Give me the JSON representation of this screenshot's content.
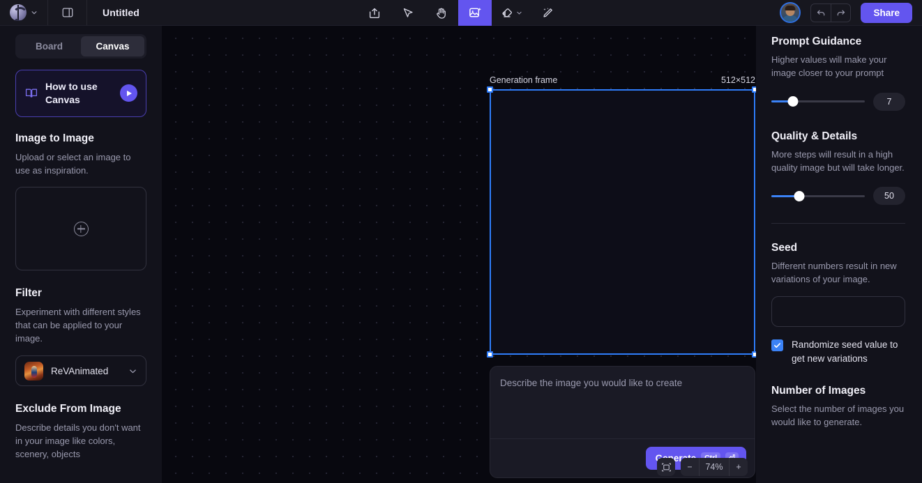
{
  "topbar": {
    "logo_icon": "app-logo",
    "workspace_chevron_icon": "chevron-down-icon",
    "panel_toggle_icon": "sidebar-panel-icon",
    "document_title": "Untitled",
    "tools": [
      {
        "name": "import-image-tool",
        "icon": "upload-frame-icon",
        "active": false
      },
      {
        "name": "select-tool",
        "icon": "cursor-arrow-icon",
        "active": false
      },
      {
        "name": "pan-tool",
        "icon": "hand-icon",
        "active": false
      },
      {
        "name": "generate-image-tool",
        "icon": "image-sparkle-icon",
        "active": true
      },
      {
        "name": "eraser-tool",
        "icon": "eraser-icon",
        "active": false,
        "has_chevron": true
      },
      {
        "name": "magic-edit-tool",
        "icon": "magic-pen-icon",
        "active": false
      }
    ],
    "avatar_label": "user-avatar",
    "undo_icon": "undo-arrow-icon",
    "redo_icon": "redo-arrow-icon",
    "share_label": "Share"
  },
  "sidebar": {
    "tabs": [
      {
        "label": "Board",
        "active": false
      },
      {
        "label": "Canvas",
        "active": true
      }
    ],
    "howto": {
      "label": "How to use Canvas",
      "book_icon": "book-icon",
      "play_icon": "play-icon"
    },
    "image_to_image": {
      "title": "Image to Image",
      "desc": "Upload or select an image to use as inspiration.",
      "dropzone_icon": "plus-circle-icon"
    },
    "filter": {
      "title": "Filter",
      "desc": "Experiment with different styles that can be applied to your image.",
      "selected": "ReVAnimated",
      "chevron_icon": "chevron-down-icon"
    },
    "exclude": {
      "title": "Exclude From Image",
      "desc": "Describe details you don't want in your image like colors, scenery, objects"
    }
  },
  "canvas": {
    "frame_label": "Generation frame",
    "frame_size": "512×512",
    "prompt_placeholder": "Describe the image you would like to create",
    "prompt_value": "",
    "generate_label": "Generate",
    "shortcut_modifier": "Ctrl",
    "shortcut_key": "⏎",
    "fit_icon": "fit-to-screen-icon",
    "zoom_out_label": "−",
    "zoom_level": "74%",
    "zoom_in_label": "+"
  },
  "settings": {
    "prompt_guidance": {
      "title": "Prompt Guidance",
      "desc": "Higher values will make your image closer to your prompt",
      "value": "7",
      "percent": 23
    },
    "quality_details": {
      "title": "Quality & Details",
      "desc": "More steps will result in a high quality image but will take longer.",
      "value": "50",
      "percent": 30
    },
    "seed": {
      "title": "Seed",
      "desc": "Different numbers result in new variations of your image.",
      "value": "",
      "placeholder": "",
      "randomize_label": "Randomize seed value to get new variations",
      "randomize_checked": true
    },
    "number_of_images": {
      "title": "Number of Images",
      "desc": "Select the number of images you would like to generate."
    }
  },
  "colors": {
    "accent_purple": "#6355ef",
    "accent_blue": "#3b82f6",
    "frame_blue": "#2f7dfb"
  }
}
